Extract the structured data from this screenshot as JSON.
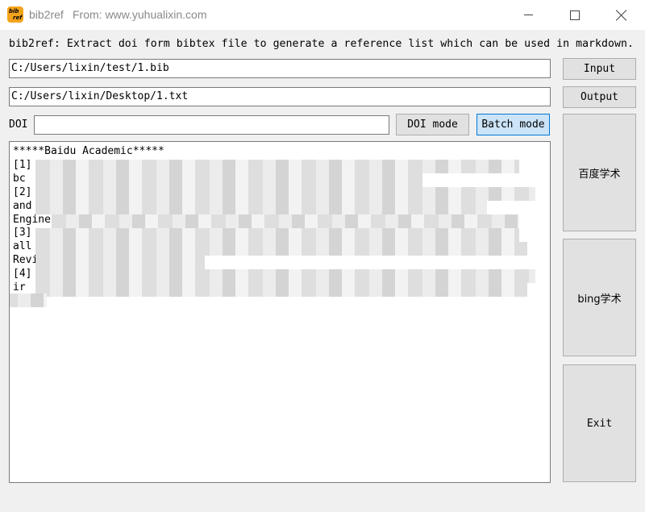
{
  "titlebar": {
    "app_name": "bib2ref",
    "from_text": "From: www.yuhualixin.com",
    "icon_text_1": "bib",
    "icon_text_2": "ref"
  },
  "description": "bib2ref: Extract doi form bibtex file to generate a reference list which can be used in markdown.",
  "input_path": "C:/Users/lixin/test/1.bib",
  "output_path": "C:/Users/lixin/Desktop/1.txt",
  "doi": {
    "label": "DOI",
    "value": ""
  },
  "buttons": {
    "input": "Input",
    "output": "Output",
    "doi_mode": "DOI mode",
    "batch_mode": "Batch mode",
    "baidu": "百度学术",
    "bing": "bing学术",
    "exit": "Exit"
  },
  "output_text": "*****Baidu Academic*****\n[1]\nbc\n[2]\nand\nEngine\n[3]\nall\nRevi\n[4]\nir",
  "colors": {
    "batch_active_bg": "#cce4f7",
    "batch_active_border": "#0078d7",
    "app_icon": "#f3a41c"
  }
}
